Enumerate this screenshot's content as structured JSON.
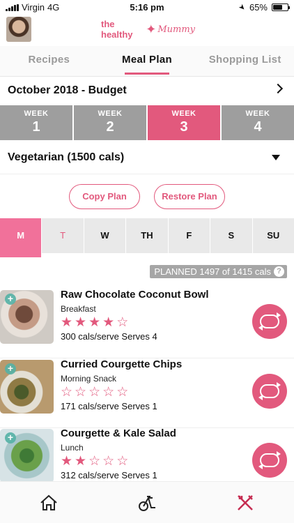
{
  "status": {
    "carrier": "Virgin",
    "network": "4G",
    "time": "5:16 pm",
    "battery": "65%",
    "battery_fraction": 0.65
  },
  "header": {
    "logo_prefix": "the healthy",
    "logo_suffix": "Mummy"
  },
  "tabs": [
    {
      "label": "Recipes",
      "active": false
    },
    {
      "label": "Meal Plan",
      "active": true
    },
    {
      "label": "Shopping List",
      "active": false
    }
  ],
  "plan": {
    "month": "October 2018 - Budget",
    "diet": "Vegetarian (1500 cals)"
  },
  "weeks": [
    {
      "label": "WEEK",
      "num": "1",
      "active": false
    },
    {
      "label": "WEEK",
      "num": "2",
      "active": false
    },
    {
      "label": "WEEK",
      "num": "3",
      "active": true
    },
    {
      "label": "WEEK",
      "num": "4",
      "active": false
    }
  ],
  "buttons": {
    "copy": "Copy Plan",
    "restore": "Restore Plan"
  },
  "days": [
    "M",
    "T",
    "W",
    "TH",
    "F",
    "S",
    "SU"
  ],
  "active_day": "M",
  "planned": {
    "text": "PLANNED 1497 of 1415 cals",
    "help": "?"
  },
  "meals": [
    {
      "name": "Raw Chocolate Coconut Bowl",
      "type": "Breakfast",
      "rating": 4,
      "meta": "300 cals/serve  Serves 4"
    },
    {
      "name": "Curried Courgette Chips",
      "type": "Morning Snack",
      "rating": 0,
      "meta": "171 cals/serve  Serves 1"
    },
    {
      "name": "Courgette & Kale Salad",
      "type": "Lunch",
      "rating": 2,
      "meta": "312 cals/serve  Serves 1"
    }
  ],
  "colors": {
    "accent": "#e2597d",
    "grey_tab": "#9e9e9e",
    "teal": "#55b2a6"
  },
  "nav": [
    "home-icon",
    "exercise-bike-icon",
    "cutlery-icon"
  ]
}
